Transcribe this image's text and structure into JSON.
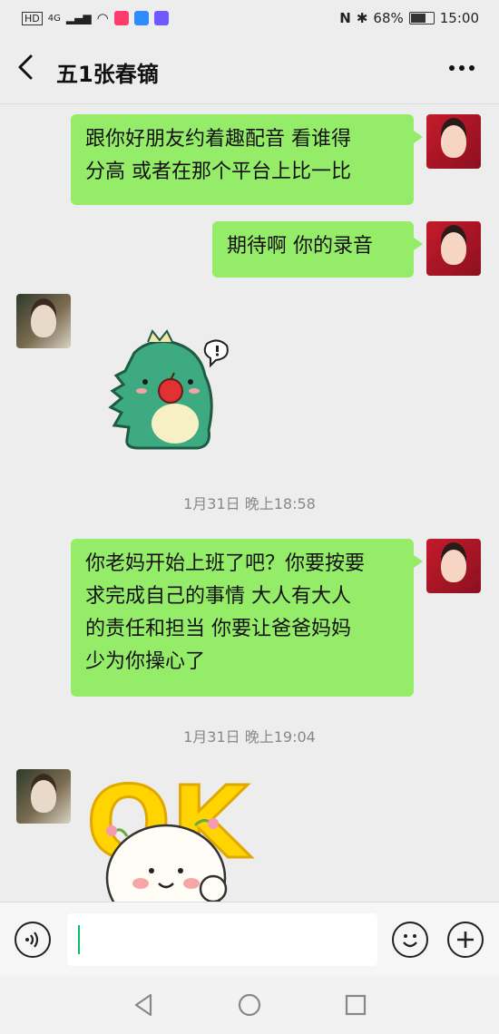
{
  "status_bar": {
    "left": [
      "HD",
      "4G"
    ],
    "battery": "68%",
    "time": "15:00"
  },
  "chat": {
    "title": "五1张春镝",
    "back_icon": "back-arrow-icon",
    "more_icon": "more-dots-icon"
  },
  "messages": [
    {
      "type": "text",
      "side": "right",
      "text": "跟你好朋友约着趣配音 看谁得\n分高 或者在那个平台上比一比"
    },
    {
      "type": "text",
      "side": "right",
      "text": "期待啊 你的录音"
    },
    {
      "type": "sticker",
      "side": "left",
      "sticker": "green-dinosaur-apple-sticker"
    },
    {
      "type": "timestamp",
      "text": "1月31日 晚上18:58"
    },
    {
      "type": "text",
      "side": "right",
      "text": "你老妈开始上班了吧？你要按要\n求完成自己的事情 大人有大人\n的责任和担当 你要让爸爸妈妈\n少为你操心了"
    },
    {
      "type": "timestamp",
      "text": "1月31日 晚上19:04"
    },
    {
      "type": "sticker",
      "side": "left",
      "sticker": "ok-bun-sticker",
      "text": "OK"
    }
  ],
  "input_bar": {
    "voice_icon": "voice-icon",
    "emoji_icon": "emoji-icon",
    "plus_icon": "plus-icon",
    "value": ""
  },
  "colors": {
    "bubble_green": "#95ec69",
    "chat_bg": "#ededed"
  }
}
